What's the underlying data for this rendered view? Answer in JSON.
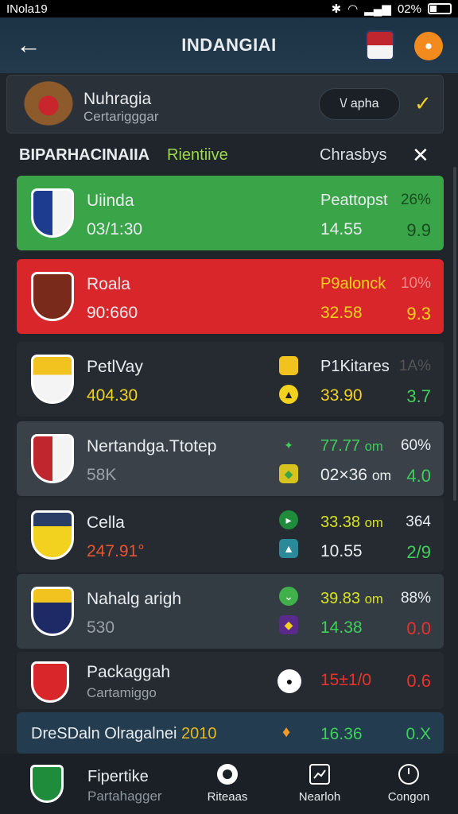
{
  "status": {
    "time": "INola19",
    "battery": "02%"
  },
  "appbar": {
    "title": "INDANGIAI",
    "back": "←"
  },
  "profile": {
    "name": "Nuhragia",
    "sub": "Certarigggar",
    "pill": "\\/ apha",
    "check": "✓"
  },
  "tabs": {
    "t1": "BIPARHACINAIIA",
    "t2": "Rientiive",
    "t3": "Chrasbys",
    "close": "✕"
  },
  "rows": [
    {
      "n1": "Uiinda",
      "n2": "03/1:30",
      "v1": "Peattopst",
      "v2": "14.55",
      "p1": "26%",
      "p2": "9.9",
      "crest": "#1d3b8f"
    },
    {
      "n1": "Roala",
      "n2": "90:660",
      "v1": "P9alonck",
      "v2": "32.58",
      "p1": "10%",
      "p2": "9.3",
      "crest": "#c0262d"
    },
    {
      "n1": "PetlVay",
      "n2": "404.30",
      "v1": "P1Kitares",
      "v2": "33.90",
      "p1": "1A%",
      "p2": "3.7",
      "crest": "#f2c21e"
    },
    {
      "n1": "Nertandga.Ttotep",
      "n2": "58K",
      "v1": "77.77",
      "v1u": "om",
      "v2": "02×36",
      "v2u": "om",
      "p1": "60%",
      "p2": "4.0",
      "crest": "#c0262d"
    },
    {
      "n1": "Cella",
      "n2": "247.91°",
      "v1": "33.38",
      "v1u": "om",
      "v2": "10.55",
      "p1": "364",
      "p2": "2/9",
      "crest": "#e8b81c"
    },
    {
      "n1": "Nahalg arigh",
      "n2": "530",
      "v1": "39.83",
      "v1u": "om",
      "v2": "14.38",
      "p1": "88%",
      "p2": "0.0",
      "crest": "#d8262b"
    },
    {
      "n1": "Packaggah",
      "n2": "Cartamiggo",
      "v1": "15±1/0",
      "v2": "",
      "p1": "",
      "p2": "0.6",
      "crest": "#d8262b"
    }
  ],
  "banner": {
    "label": "DreSDaln Olragalnei",
    "year": "2010",
    "value": "16.36",
    "pct": "0.X"
  },
  "nav": {
    "name": "Fipertike",
    "sub": "Partahagger",
    "items": [
      "Riteaas",
      "Nearloh",
      "Congon"
    ]
  },
  "colors": {
    "green": "#3fcf5a",
    "yellow": "#f2d21e",
    "red": "#e8322e"
  }
}
